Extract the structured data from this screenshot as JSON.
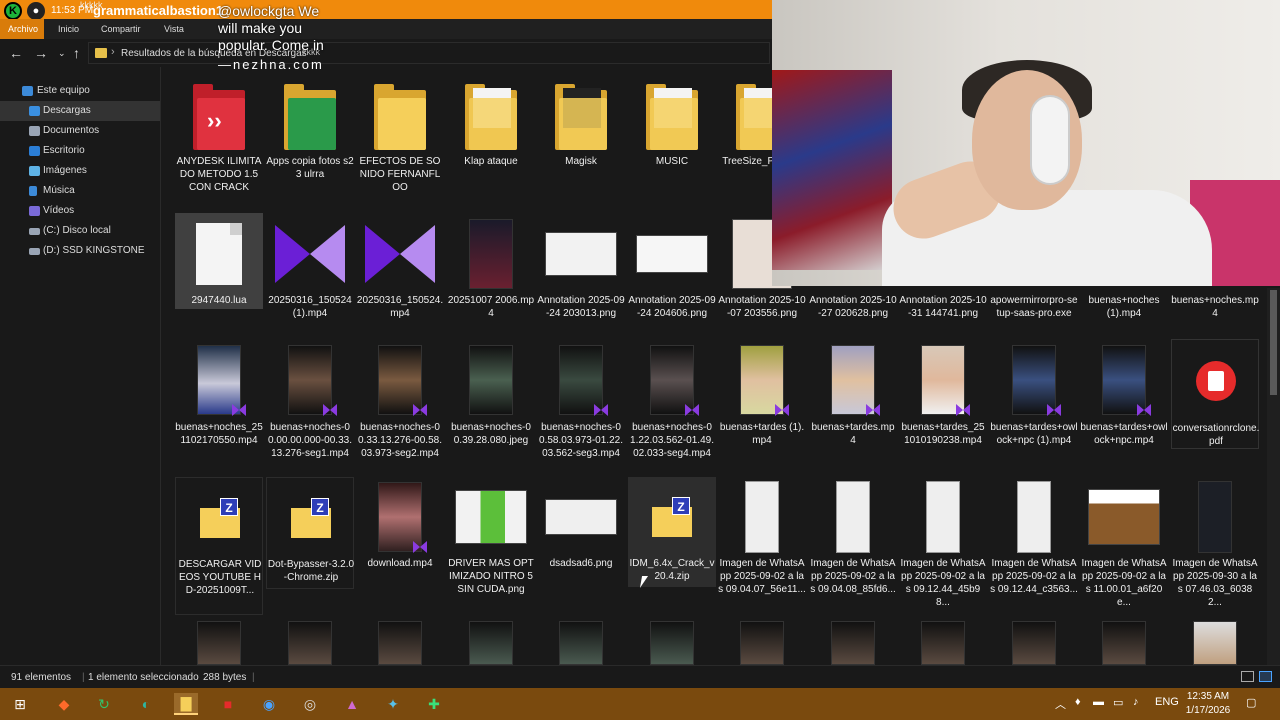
{
  "titlebar": {
    "time": "11:53 PM",
    "kkk": "kkkkk",
    "user": "grammaticalbastion1"
  },
  "overlay": {
    "line1": "@owlockgta We",
    "line2": "will make you",
    "line3": "popular. Come in",
    "watermark": "—nezhna.com"
  },
  "ribbon": {
    "archivo": "Archivo",
    "inicio": "Inicio",
    "compartir": "Compartir",
    "vista": "Vista"
  },
  "address": {
    "path": "Resultados de la búsqueda en Descargas",
    "kkk": "kkkk"
  },
  "sidebar": {
    "items": [
      {
        "label": "Este equipo",
        "icon": "computer-icon"
      },
      {
        "label": "Descargas",
        "icon": "download-folder-icon"
      },
      {
        "label": "Documentos",
        "icon": "documents-icon"
      },
      {
        "label": "Escritorio",
        "icon": "desktop-icon"
      },
      {
        "label": "Imágenes",
        "icon": "pictures-icon"
      },
      {
        "label": "Música",
        "icon": "music-icon"
      },
      {
        "label": "Vídeos",
        "icon": "videos-icon"
      },
      {
        "label": "(C:) Disco local",
        "icon": "drive-icon"
      },
      {
        "label": "(D:) SSD KINGSTONE",
        "icon": "drive-icon"
      }
    ]
  },
  "files": {
    "row1": [
      {
        "name": "ANYDESK ILIMITADO METODO 1.5 CON CRACK",
        "kind": "anydesk-folder"
      },
      {
        "name": "Apps copia fotos s23 ulrra",
        "kind": "apps-folder"
      },
      {
        "name": "EFECTOS DE SONIDO FERNANFLOO",
        "kind": "folder"
      },
      {
        "name": "Klap ataque",
        "kind": "folder-paper"
      },
      {
        "name": "Magisk",
        "kind": "magisk-folder"
      },
      {
        "name": "MUSIC",
        "kind": "folder-paper"
      },
      {
        "name": "TreeSize_P Fix-M",
        "kind": "folder-paper"
      }
    ],
    "row2": [
      {
        "name": "2947440.lua",
        "kind": "doc"
      },
      {
        "name": "20250316_150524 (1).mp4",
        "kind": "bow"
      },
      {
        "name": "20250316_150524.mp4",
        "kind": "bow"
      },
      {
        "name": "20251007 2006.mp4",
        "kind": "video"
      },
      {
        "name": "Annotation 2025-09-24 203013.png",
        "kind": "image"
      },
      {
        "name": "Annotation 2025-09-24 204606.png",
        "kind": "image"
      },
      {
        "name": "Annotation 2025-10-07 203556.png",
        "kind": "image"
      },
      {
        "name": "Annotation 2025-10-27 020628.png",
        "kind": "image"
      },
      {
        "name": "Annotation 2025-10-31 144741.png",
        "kind": "image"
      },
      {
        "name": "apowermirrorpro-setup-saas-pro.exe",
        "kind": "exe"
      },
      {
        "name": "buenas+noches (1).mp4",
        "kind": "video"
      },
      {
        "name": "buenas+noches.mp4",
        "kind": "video"
      }
    ],
    "row3": [
      {
        "name": "buenas+noches_251102170550.mp4",
        "kind": "video"
      },
      {
        "name": "buenas+noches-00.00.00.000-00.33.13.276-seg1.mp4",
        "kind": "video"
      },
      {
        "name": "buenas+noches-00.33.13.276-00.58.03.973-seg2.mp4",
        "kind": "video"
      },
      {
        "name": "buenas+noches-00.39.28.080.jpeg",
        "kind": "video-nomark"
      },
      {
        "name": "buenas+noches-00.58.03.973-01.22.03.562-seg3.mp4",
        "kind": "video"
      },
      {
        "name": "buenas+noches-01.22.03.562-01.49.02.033-seg4.mp4",
        "kind": "video"
      },
      {
        "name": "buenas+tardes (1).mp4",
        "kind": "video"
      },
      {
        "name": "buenas+tardes.mp4",
        "kind": "video"
      },
      {
        "name": "buenas+tardes_251010190238.mp4",
        "kind": "video"
      },
      {
        "name": "buenas+tardes+owlock+npc (1).mp4",
        "kind": "video"
      },
      {
        "name": "buenas+tardes+owlock+npc.mp4",
        "kind": "video"
      },
      {
        "name": "conversationrclone.pdf",
        "kind": "pdf"
      }
    ],
    "row4": [
      {
        "name": "DESCARGAR VIDEOS YOUTUBE HD-20251009T...",
        "kind": "zip"
      },
      {
        "name": "Dot-Bypasser-3.2.0-Chrome.zip",
        "kind": "zip"
      },
      {
        "name": "download.mp4",
        "kind": "video"
      },
      {
        "name": "DRIVER MAS OPTIMIZADO NITRO 5 SIN CUDA.png",
        "kind": "image"
      },
      {
        "name": "dsadsad6.png",
        "kind": "image"
      },
      {
        "name": "IDM_6.4x_Crack_v20.4.zip",
        "kind": "zip"
      },
      {
        "name": "Imagen de WhatsApp 2025-09-02 a las 09.04.07_56e11...",
        "kind": "phone"
      },
      {
        "name": "Imagen de WhatsApp 2025-09-02 a las 09.04.08_85fd6...",
        "kind": "phone"
      },
      {
        "name": "Imagen de WhatsApp 2025-09-02 a las 09.12.44_45b98...",
        "kind": "phone"
      },
      {
        "name": "Imagen de WhatsApp 2025-09-02 a las 09.12.44_c3563...",
        "kind": "phone"
      },
      {
        "name": "Imagen de WhatsApp 2025-09-02 a las 11.00.01_a6f20e...",
        "kind": "image"
      },
      {
        "name": "Imagen de WhatsApp 2025-09-30 a las 07.46.03_60382...",
        "kind": "phone-dark"
      }
    ]
  },
  "status": {
    "count": "91 elementos",
    "selected": "1 elemento seleccionado",
    "size": "288 bytes"
  },
  "taskbar": {
    "lang": "ENG",
    "time": "12:35 AM",
    "date": "1/17/2026"
  }
}
